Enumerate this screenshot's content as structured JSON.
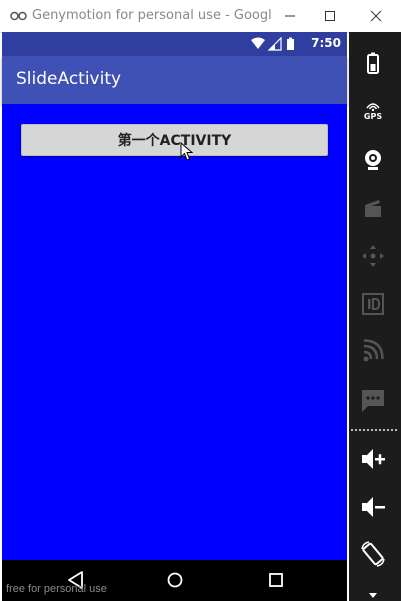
{
  "window": {
    "title": "Genymotion for personal use - Googl..."
  },
  "statusbar": {
    "time": "7:50"
  },
  "appbar": {
    "title": "SlideActivity"
  },
  "content": {
    "background_color": "#0000ff",
    "first_button_label": "第一个ACTIVITY"
  },
  "toolbar": {
    "gps_label": "GPS",
    "items": [
      "battery-icon",
      "gps-icon",
      "webcam-icon",
      "video-capture-icon",
      "dpad-icon",
      "id-icon",
      "cast-icon",
      "sms-icon",
      "volume-up-icon",
      "volume-down-icon",
      "rotate-icon"
    ]
  },
  "watermark": "free for personal use",
  "colors": {
    "statusbar": "#303f9f",
    "appbar": "#3f51b5",
    "content": "#0000ff"
  }
}
